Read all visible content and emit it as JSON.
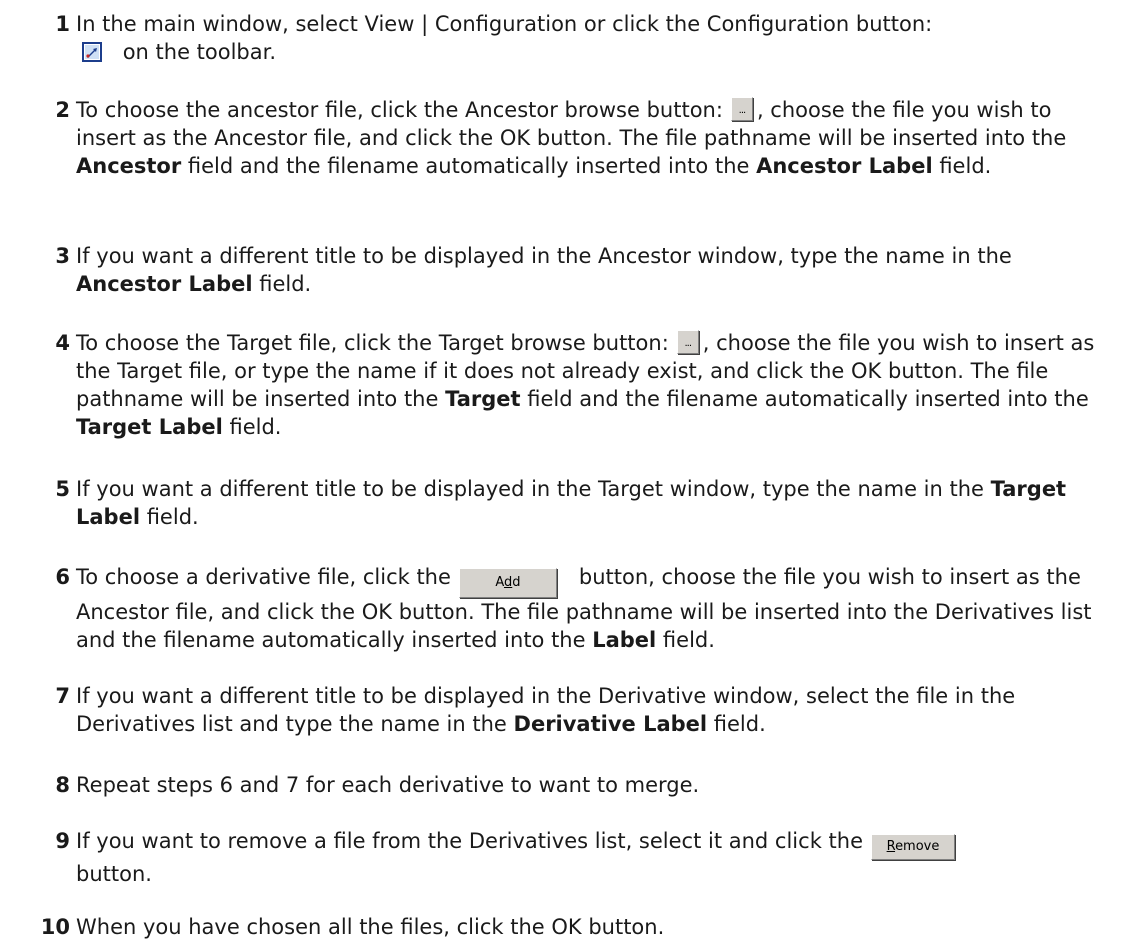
{
  "steps": [
    {
      "num": "1",
      "pre": "In the main window, select View | Configuration or click the Configuration button:",
      "post": "on the toolbar."
    },
    {
      "num": "2",
      "pre": "To choose the ancestor file, click the Ancestor browse button:",
      "mid": ", choose the file you wish to insert as the Ancestor file, and click the OK button. The file pathname will be inserted into the ",
      "b1": "Ancestor",
      "mid2": " field and the filename automatically inserted into the ",
      "b2": "Ancestor Label",
      "post": " field."
    },
    {
      "num": "3",
      "pre": "If you want a different title to be displayed in the Ancestor window, type the name in the ",
      "b1": "Ancestor Label",
      "post": " field."
    },
    {
      "num": "4",
      "pre": "To choose the Target file, click the Target browse button:",
      "mid": ", choose the file you wish to insert as the Target file, or type the name if it does not already exist, and click the OK button. The file pathname will be inserted into the ",
      "b1": "Target",
      "mid2": " field and the filename automatically inserted into the ",
      "b2": "Target Label",
      "post": " field."
    },
    {
      "num": "5",
      "pre": "If you want a different title to be displayed in the Target window, type the name in the ",
      "b1": "Target Label",
      "post": " field."
    },
    {
      "num": "6",
      "pre": "To choose a derivative file, click the",
      "mid": "button, choose the file you wish to insert as the Ancestor file, and click the OK button. The file pathname will be inserted into the Derivatives list and the filename automatically inserted into the ",
      "b1": "Label",
      "post": " field."
    },
    {
      "num": "7",
      "pre": "If you want a different title to be displayed in the Derivative window, select the file in the Derivatives list and type the name in the ",
      "b1": "Derivative Label",
      "post": " field."
    },
    {
      "num": "8",
      "pre": "Repeat steps 6 and 7 for each derivative to want to merge."
    },
    {
      "num": "9",
      "pre": "If you want to remove a file from the Derivatives list, select it and click the",
      "post": "button."
    },
    {
      "num": "10",
      "pre": "When you have chosen all the files, click the OK button."
    }
  ],
  "buttons": {
    "browse_label": "...",
    "add_pre": "A",
    "add_ul": "d",
    "add_post": "d",
    "remove_ul": "R",
    "remove_post": "emove"
  }
}
